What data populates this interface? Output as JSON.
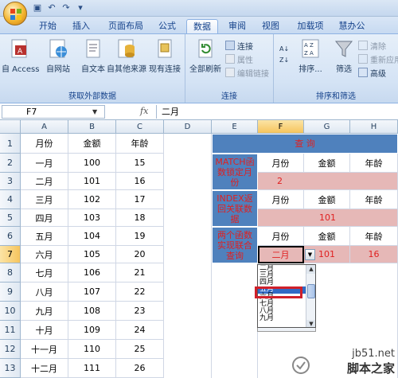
{
  "ribbon_tabs": [
    "开始",
    "插入",
    "页面布局",
    "公式",
    "数据",
    "审阅",
    "视图",
    "加载项",
    "慧办公"
  ],
  "active_tab": "数据",
  "ribbon": {
    "group_external": {
      "label": "获取外部数据",
      "buttons": [
        "自 Access",
        "自网站",
        "自文本",
        "自其他来源",
        "现有连接"
      ]
    },
    "group_connections": {
      "label": "连接",
      "refresh_all": "全部刷新",
      "items": [
        "连接",
        "属性",
        "编辑链接"
      ]
    },
    "group_sort": {
      "label": "排序和筛选",
      "sort": "排序...",
      "filter": "筛选",
      "items": [
        "清除",
        "重新应用",
        "高级"
      ]
    }
  },
  "formula_bar": {
    "name_box": "F7",
    "fx": "fx",
    "content": "二月"
  },
  "columns": [
    "A",
    "B",
    "C",
    "D",
    "E",
    "F",
    "G",
    "H"
  ],
  "rows": [
    "1",
    "2",
    "3",
    "4",
    "5",
    "6",
    "7",
    "8",
    "9",
    "10",
    "11",
    "12",
    "13"
  ],
  "table": {
    "headers": [
      "月份",
      "金额",
      "年龄"
    ],
    "rows": [
      [
        "一月",
        "100",
        "15"
      ],
      [
        "二月",
        "101",
        "16"
      ],
      [
        "三月",
        "102",
        "17"
      ],
      [
        "四月",
        "103",
        "18"
      ],
      [
        "五月",
        "104",
        "19"
      ],
      [
        "六月",
        "105",
        "20"
      ],
      [
        "七月",
        "106",
        "21"
      ],
      [
        "八月",
        "107",
        "22"
      ],
      [
        "九月",
        "108",
        "23"
      ],
      [
        "十月",
        "109",
        "24"
      ],
      [
        "十一月",
        "110",
        "25"
      ],
      [
        "十二月",
        "111",
        "26"
      ]
    ]
  },
  "query": {
    "title": "查 询",
    "match_label": "MATCH函数锁定月份",
    "index_label": "INDEX返回关联数据",
    "combo_label": "两个函数实现联合查询",
    "h_month": "月份",
    "h_amount": "金额",
    "h_age": "年龄",
    "match_result": "2",
    "index_result": "101",
    "combo_month": "二月",
    "combo_amount": "101",
    "combo_age": "16"
  },
  "dropdown": {
    "items": [
      "二月",
      "三月",
      "四月",
      "五月",
      "六月",
      "七月",
      "八月",
      "九月"
    ],
    "highlighted": "五月"
  },
  "watermark": {
    "url": "jb51.net",
    "name": "脚本之家"
  }
}
